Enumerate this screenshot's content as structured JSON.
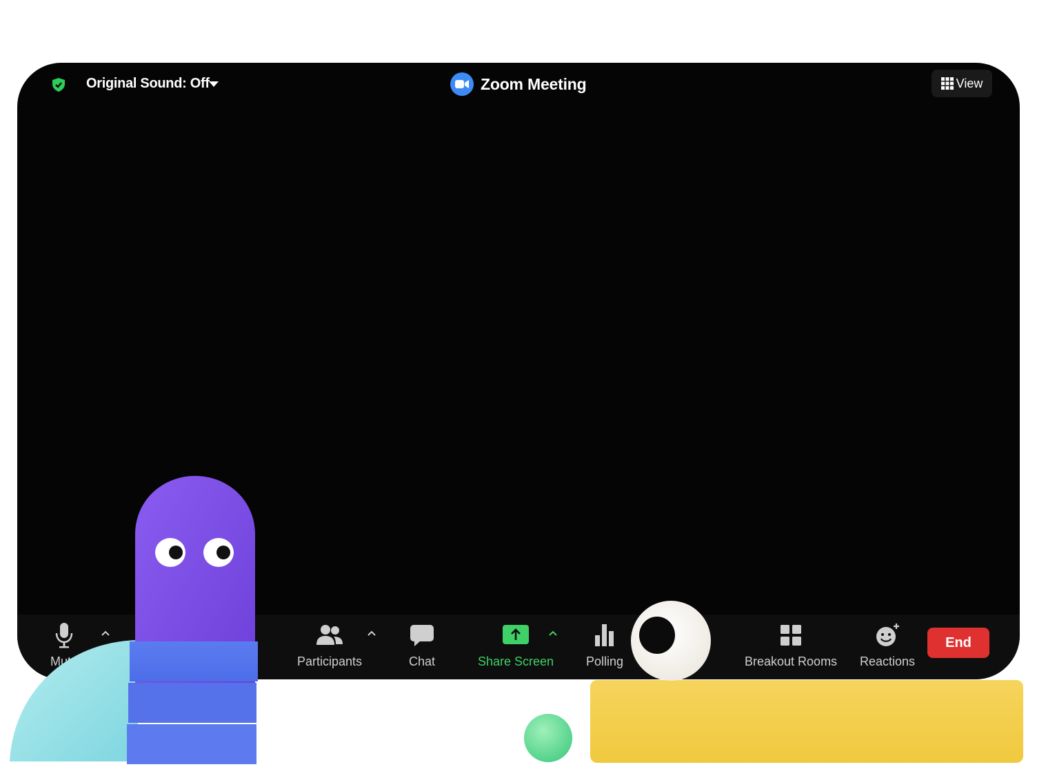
{
  "header": {
    "sound_label": "Original Sound: Off",
    "title": "Zoom Meeting",
    "view_label": "View"
  },
  "toolbar": {
    "mute_label": "Mute",
    "participants_label": "Participants",
    "chat_label": "Chat",
    "share_label": "Share Screen",
    "polling_label": "Polling",
    "breakout_label": "Breakout Rooms",
    "reactions_label": "Reactions",
    "end_label": "End"
  },
  "colors": {
    "window_bg": "#050505",
    "share_green": "#3fd067",
    "end_red": "#e03131",
    "zoom_blue": "#3d8cf5"
  }
}
